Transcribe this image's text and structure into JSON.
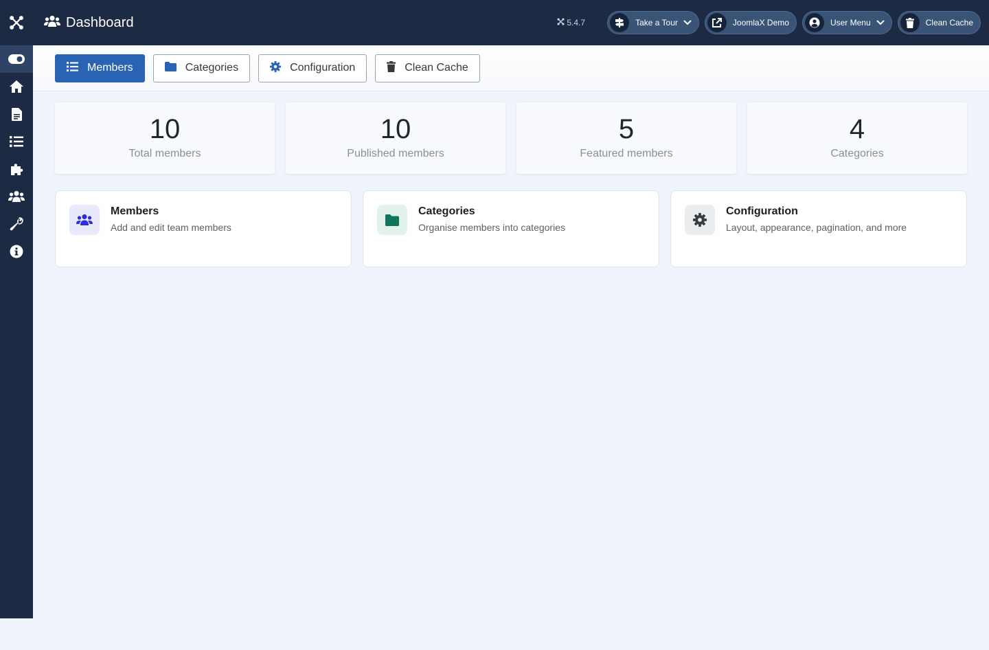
{
  "header": {
    "title": "Dashboard",
    "version": "5.4.7",
    "buttons": [
      {
        "label": "Take a Tour",
        "icon": "signs-post-icon",
        "dropdown": true
      },
      {
        "label": "JoomlaX Demo",
        "icon": "external-link-icon",
        "dropdown": false
      },
      {
        "label": "User Menu",
        "icon": "user-circle-icon",
        "dropdown": true
      },
      {
        "label": "Clean Cache",
        "icon": "trash-icon",
        "dropdown": false
      }
    ]
  },
  "sidebar": {
    "items": [
      {
        "icon": "toggle-icon",
        "active": true
      },
      {
        "icon": "home-icon"
      },
      {
        "icon": "file-icon"
      },
      {
        "icon": "list-icon"
      },
      {
        "icon": "puzzle-icon"
      },
      {
        "icon": "users-icon"
      },
      {
        "icon": "wrench-icon"
      },
      {
        "icon": "info-icon"
      }
    ]
  },
  "toolbar": {
    "members": "Members",
    "categories": "Categories",
    "configuration": "Configuration",
    "clean_cache": "Clean Cache"
  },
  "stats": [
    {
      "value": "10",
      "label": "Total members"
    },
    {
      "value": "10",
      "label": "Published members"
    },
    {
      "value": "5",
      "label": "Featured members"
    },
    {
      "value": "4",
      "label": "Categories"
    }
  ],
  "cards": [
    {
      "title": "Members",
      "description": "Add and edit team members",
      "icon": "users-icon",
      "color": "#2d2fd6",
      "bg": "#e8e9fb"
    },
    {
      "title": "Categories",
      "description": "Organise members into categories",
      "icon": "folder-icon",
      "color": "#11755e",
      "bg": "#e1f1ec"
    },
    {
      "title": "Configuration",
      "description": "Layout, appearance, pagination, and more",
      "icon": "gear-icon",
      "color": "#383d42",
      "bg": "#ebecee"
    }
  ],
  "colors": {
    "header_bg": "#1c2b43",
    "primary": "#2b63b4",
    "page_bg": "#eff3fb"
  }
}
